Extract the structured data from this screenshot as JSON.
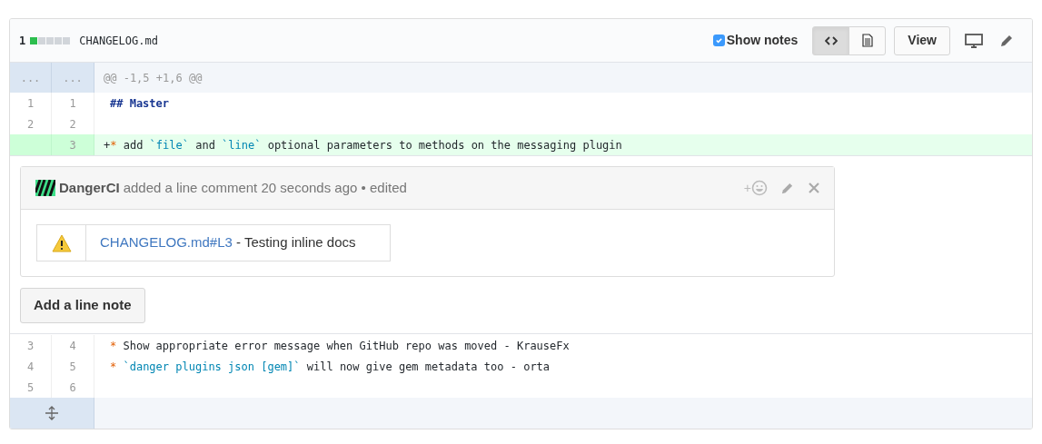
{
  "file_header": {
    "changes": "1",
    "diffstat": [
      {
        "kind": "added"
      },
      {
        "kind": "neutral"
      },
      {
        "kind": "neutral"
      },
      {
        "kind": "neutral"
      },
      {
        "kind": "neutral"
      }
    ],
    "filename": "CHANGELOG.md",
    "show_notes": {
      "label": "Show notes",
      "checked": true
    },
    "view_toggle": [
      {
        "kind": "code",
        "selected": true
      },
      {
        "kind": "document",
        "selected": false
      }
    ],
    "view_button": "View"
  },
  "hunk": {
    "old": "...",
    "new": "...",
    "text": "@@ -1,5 +1,6 @@"
  },
  "lines_before": [
    {
      "old": "1",
      "new": "1",
      "kind": "context",
      "tokens": [
        {
          "kind": "heading",
          "text": "## Master"
        }
      ]
    },
    {
      "old": "2",
      "new": "2",
      "kind": "context"
    },
    {
      "new": "3",
      "kind": "added",
      "tokens": [
        {
          "kind": "plain",
          "text": "+"
        },
        {
          "kind": "bullet",
          "text": "*"
        },
        {
          "kind": "plain",
          "text": " add "
        },
        {
          "kind": "code",
          "text": "`file`"
        },
        {
          "kind": "plain",
          "text": " and "
        },
        {
          "kind": "code",
          "text": "`line`"
        },
        {
          "kind": "plain",
          "text": " optional parameters to methods on the messaging plugin"
        }
      ]
    }
  ],
  "comment": {
    "author": "DangerCI",
    "meta": "added a line comment 20 seconds ago • edited",
    "reaction": "+",
    "table": {
      "link": "CHANGELOG.md#L3",
      "text": " - Testing inline docs"
    }
  },
  "add_note_button": "Add a line note",
  "lines_after": [
    {
      "old": "3",
      "new": "4",
      "kind": "context",
      "tokens": [
        {
          "kind": "bullet",
          "text": "*"
        },
        {
          "kind": "plain",
          "text": " Show appropriate error message when GitHub repo was moved - KrauseFx"
        }
      ]
    },
    {
      "old": "4",
      "new": "5",
      "kind": "context",
      "tokens": [
        {
          "kind": "bullet",
          "text": "*"
        },
        {
          "kind": "code",
          "text": " `danger plugins json [gem]`"
        },
        {
          "kind": "plain",
          "text": " will now give gem metadata too - orta"
        }
      ]
    },
    {
      "old": "5",
      "new": "6",
      "kind": "context"
    }
  ]
}
